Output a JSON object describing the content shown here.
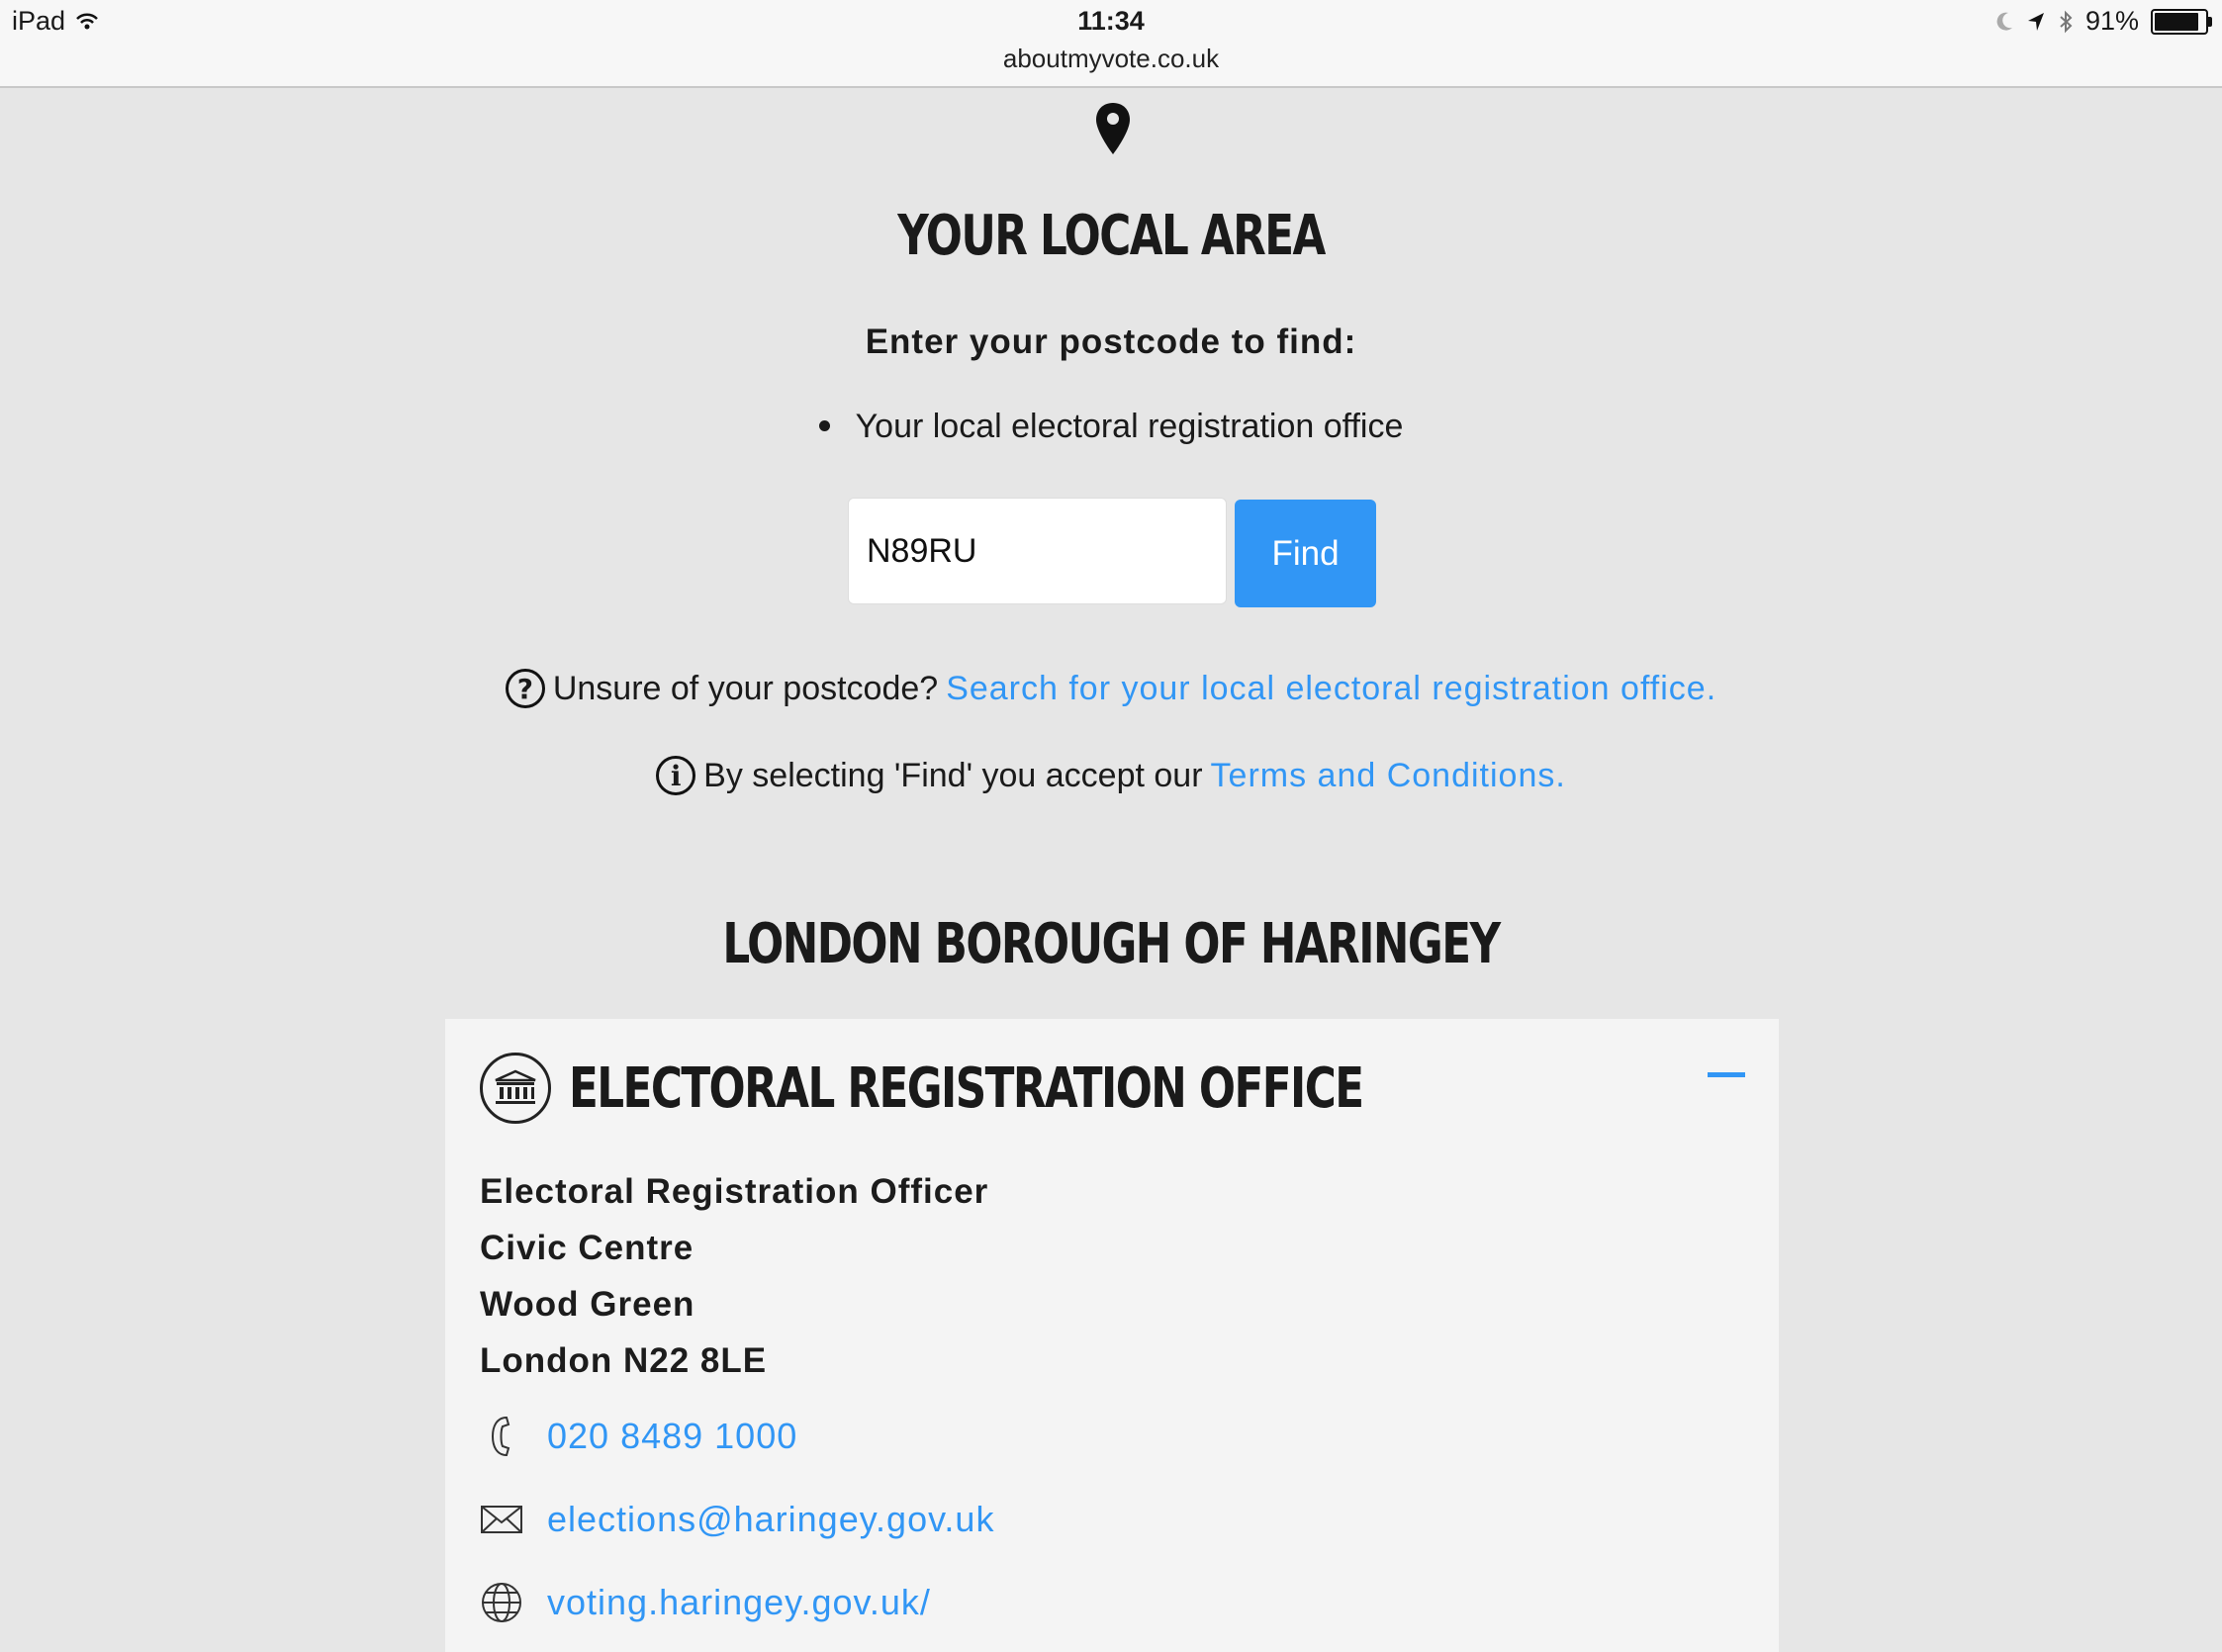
{
  "status_bar": {
    "device": "iPad",
    "time": "11:34",
    "url": "aboutmyvote.co.uk",
    "battery": "91%",
    "battery_level": 0.91
  },
  "search": {
    "heading": "YOUR LOCAL AREA",
    "intro": "Enter your postcode to find:",
    "bullet": "Your local electoral registration office",
    "postcode_value": "N89RU",
    "find_label": "Find",
    "unsure_text": "Unsure of your postcode?",
    "unsure_link": "Search for your local electoral registration office.",
    "terms_text": "By selecting 'Find' you accept our",
    "terms_link": "Terms and Conditions."
  },
  "result": {
    "borough": "LONDON BOROUGH OF HARINGEY",
    "office_title": "ELECTORAL REGISTRATION OFFICE",
    "address": [
      "Electoral Registration Officer",
      "Civic Centre",
      "Wood Green",
      "London N22 8LE"
    ],
    "phone": "020 8489 1000",
    "email": "elections@haringey.gov.uk",
    "website": "voting.haringey.gov.uk/"
  },
  "colors": {
    "accent": "#3196f5",
    "background": "#e6e6e6",
    "panel": "#f4f4f4"
  },
  "icons": [
    "wifi-icon",
    "moon-icon",
    "location-arrow-icon",
    "bluetooth-icon",
    "battery-icon",
    "map-pin-icon",
    "question-icon",
    "info-icon",
    "building-icon",
    "minus-icon",
    "phone-icon",
    "envelope-icon",
    "globe-icon"
  ]
}
